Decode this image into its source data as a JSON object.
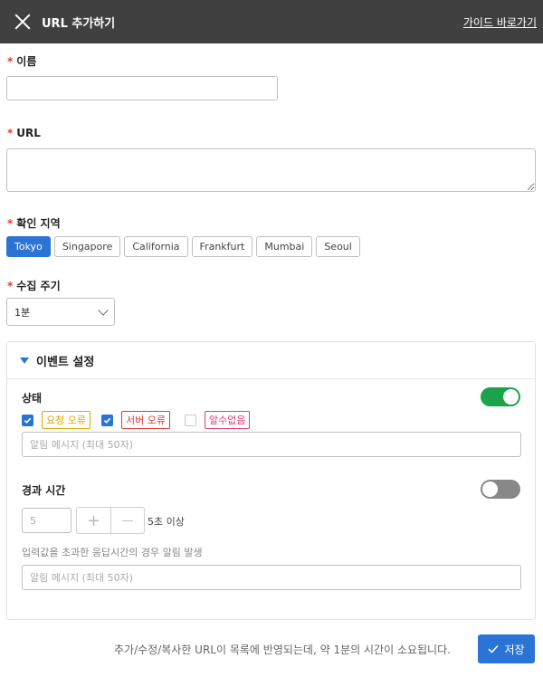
{
  "header": {
    "title": "URL 추가하기",
    "guide_link": "가이드 바로가기"
  },
  "form": {
    "required_mark": "*",
    "name_label": "이름",
    "name_value": "",
    "url_label": "URL",
    "url_value": "",
    "region_label": "확인 지역",
    "regions": [
      {
        "label": "Tokyo",
        "selected": true
      },
      {
        "label": "Singapore",
        "selected": false
      },
      {
        "label": "California",
        "selected": false
      },
      {
        "label": "Frankfurt",
        "selected": false
      },
      {
        "label": "Mumbai",
        "selected": false
      },
      {
        "label": "Seoul",
        "selected": false
      }
    ],
    "interval_label": "수집 주기",
    "interval_value": "1분"
  },
  "event": {
    "title": "이벤트 설정",
    "status_label": "상태",
    "status_enabled": true,
    "status_options": [
      {
        "label": "요청 오류",
        "checked": true,
        "color": "#e0a800"
      },
      {
        "label": "서버 오류",
        "checked": true,
        "color": "#e03a3a"
      },
      {
        "label": "알수없음",
        "checked": false,
        "color": "#e0407a"
      }
    ],
    "status_message_placeholder": "알림 메시지 (최대 50자)",
    "elapsed_label": "경과 시간",
    "elapsed_enabled": false,
    "elapsed_value_placeholder": "5",
    "elapsed_plus": "+",
    "elapsed_minus": "—",
    "elapsed_suffix": "5초 이상",
    "elapsed_desc": "입력값을 초과한 응답시간의 경우 알림 발생",
    "elapsed_message_placeholder": "알림 메시지 (최대 50자)"
  },
  "footer": {
    "notice": "추가/수정/복사한 URL이 목록에 반영되는데, 약 1분의 시간이 소요됩니다.",
    "save_label": "저장"
  },
  "colors": {
    "header_bg": "#404040",
    "accent": "#2a74d5",
    "toggle_on": "#1aa34a",
    "required": "#e03a3a"
  }
}
